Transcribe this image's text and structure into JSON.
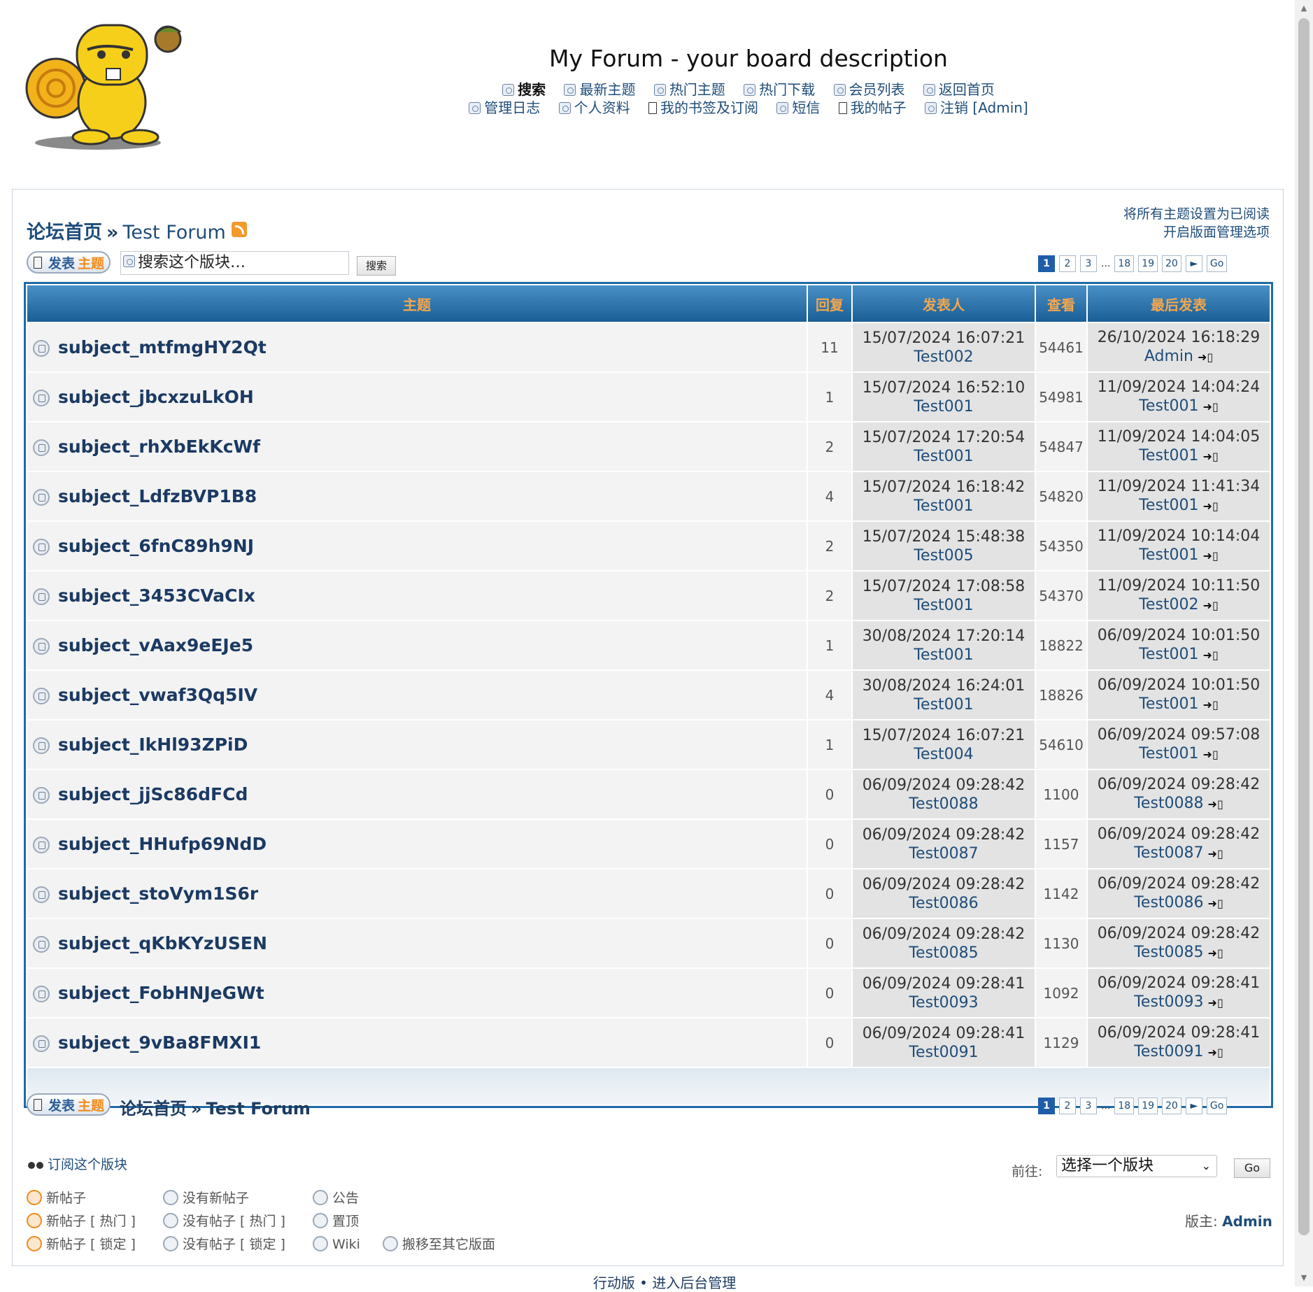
{
  "board": {
    "title": "My Forum - your board description",
    "nav_row1": [
      "搜索",
      "最新主题",
      "热门主题",
      "热门下载",
      "会员列表",
      "返回首页"
    ],
    "nav_row2": [
      "管理日志",
      "个人资料",
      "我的书签及订阅",
      "短信",
      "我的帖子",
      "注销 [Admin]"
    ]
  },
  "breadcrumb": {
    "home": "论坛首页",
    "sep": "»",
    "forum": "Test Forum"
  },
  "right_links": [
    "将所有主题设置为已阅读",
    "开启版面管理选项"
  ],
  "post_button": {
    "a": "发表",
    "b": "主题"
  },
  "search": {
    "placeholder": "搜索这个版块…",
    "button": "搜索"
  },
  "pagination": [
    "1",
    "2",
    "3",
    "...",
    "18",
    "19",
    "20",
    "►",
    "Go"
  ],
  "table": {
    "headers": [
      "主题",
      "回复",
      "发表人",
      "查看",
      "最后发表"
    ],
    "rows": [
      {
        "subject": "subject_mtfmgHY2Qt",
        "replies": "11",
        "date": "15/07/2024 16:07:21",
        "author": "Test002",
        "views": "54461",
        "last_date": "26/10/2024 16:18:29",
        "last_user": "Admin"
      },
      {
        "subject": "subject_jbcxzuLkOH",
        "replies": "1",
        "date": "15/07/2024 16:52:10",
        "author": "Test001",
        "views": "54981",
        "last_date": "11/09/2024 14:04:24",
        "last_user": "Test001"
      },
      {
        "subject": "subject_rhXbEkKcWf",
        "replies": "2",
        "date": "15/07/2024 17:20:54",
        "author": "Test001",
        "views": "54847",
        "last_date": "11/09/2024 14:04:05",
        "last_user": "Test001"
      },
      {
        "subject": "subject_LdfzBVP1B8",
        "replies": "4",
        "date": "15/07/2024 16:18:42",
        "author": "Test001",
        "views": "54820",
        "last_date": "11/09/2024 11:41:34",
        "last_user": "Test001"
      },
      {
        "subject": "subject_6fnC89h9NJ",
        "replies": "2",
        "date": "15/07/2024 15:48:38",
        "author": "Test005",
        "views": "54350",
        "last_date": "11/09/2024 10:14:04",
        "last_user": "Test001"
      },
      {
        "subject": "subject_3453CVaCIx",
        "replies": "2",
        "date": "15/07/2024 17:08:58",
        "author": "Test001",
        "views": "54370",
        "last_date": "11/09/2024 10:11:50",
        "last_user": "Test002"
      },
      {
        "subject": "subject_vAax9eEJe5",
        "replies": "1",
        "date": "30/08/2024 17:20:14",
        "author": "Test001",
        "views": "18822",
        "last_date": "06/09/2024 10:01:50",
        "last_user": "Test001"
      },
      {
        "subject": "subject_vwaf3Qq5IV",
        "replies": "4",
        "date": "30/08/2024 16:24:01",
        "author": "Test001",
        "views": "18826",
        "last_date": "06/09/2024 10:01:50",
        "last_user": "Test001"
      },
      {
        "subject": "subject_IkHl93ZPiD",
        "replies": "1",
        "date": "15/07/2024 16:07:21",
        "author": "Test004",
        "views": "54610",
        "last_date": "06/09/2024 09:57:08",
        "last_user": "Test001"
      },
      {
        "subject": "subject_jjSc86dFCd",
        "replies": "0",
        "date": "06/09/2024 09:28:42",
        "author": "Test0088",
        "views": "1100",
        "last_date": "06/09/2024 09:28:42",
        "last_user": "Test0088"
      },
      {
        "subject": "subject_HHufp69NdD",
        "replies": "0",
        "date": "06/09/2024 09:28:42",
        "author": "Test0087",
        "views": "1157",
        "last_date": "06/09/2024 09:28:42",
        "last_user": "Test0087"
      },
      {
        "subject": "subject_stoVym1S6r",
        "replies": "0",
        "date": "06/09/2024 09:28:42",
        "author": "Test0086",
        "views": "1142",
        "last_date": "06/09/2024 09:28:42",
        "last_user": "Test0086"
      },
      {
        "subject": "subject_qKbKYzUSEN",
        "replies": "0",
        "date": "06/09/2024 09:28:42",
        "author": "Test0085",
        "views": "1130",
        "last_date": "06/09/2024 09:28:42",
        "last_user": "Test0085"
      },
      {
        "subject": "subject_FobHNJeGWt",
        "replies": "0",
        "date": "06/09/2024 09:28:41",
        "author": "Test0093",
        "views": "1092",
        "last_date": "06/09/2024 09:28:41",
        "last_user": "Test0093"
      },
      {
        "subject": "subject_9vBa8FMXI1",
        "replies": "0",
        "date": "06/09/2024 09:28:41",
        "author": "Test0091",
        "views": "1129",
        "last_date": "06/09/2024 09:28:41",
        "last_user": "Test0091"
      }
    ]
  },
  "subscribe": "订阅这个版块",
  "jump": {
    "label": "前往:",
    "selected": "选择一个版块",
    "go": "Go"
  },
  "legend": {
    "col1": [
      "新帖子",
      "新帖子 [ 热门 ]",
      "新帖子 [ 锁定 ]"
    ],
    "col2": [
      "没有新帖子",
      "没有帖子 [ 热门 ]",
      "没有帖子 [ 锁定 ]"
    ],
    "col3": [
      "公告",
      "置顶",
      "Wiki"
    ],
    "moved": "搬移至其它版面"
  },
  "moderators": {
    "label": "版主:",
    "name": "Admin"
  },
  "footer": {
    "mobile": "行动版",
    "dot": "•",
    "admin": "进入后台管理"
  }
}
